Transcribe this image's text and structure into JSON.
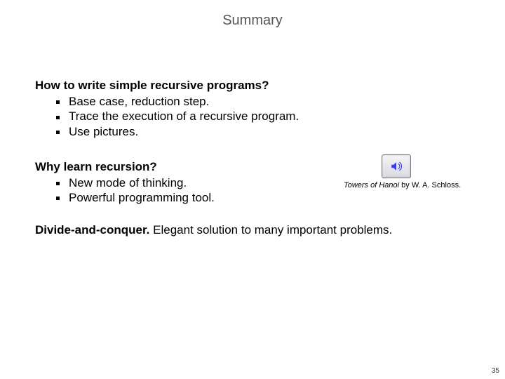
{
  "title": "Summary",
  "section1": {
    "heading": "How to write simple recursive programs?",
    "items": [
      "Base case, reduction step.",
      "Trace the execution of a recursive program.",
      "Use pictures."
    ]
  },
  "section2": {
    "heading": "Why learn recursion?",
    "items": [
      "New mode of thinking.",
      "Powerful programming tool."
    ]
  },
  "media": {
    "icon_name": "speaker-icon",
    "caption_title": "Towers of Hanoi",
    "caption_rest": " by W. A. Schloss."
  },
  "section3": {
    "lead": "Divide-and-conquer.",
    "rest": "  Elegant solution to many important problems."
  },
  "page_number": "35"
}
